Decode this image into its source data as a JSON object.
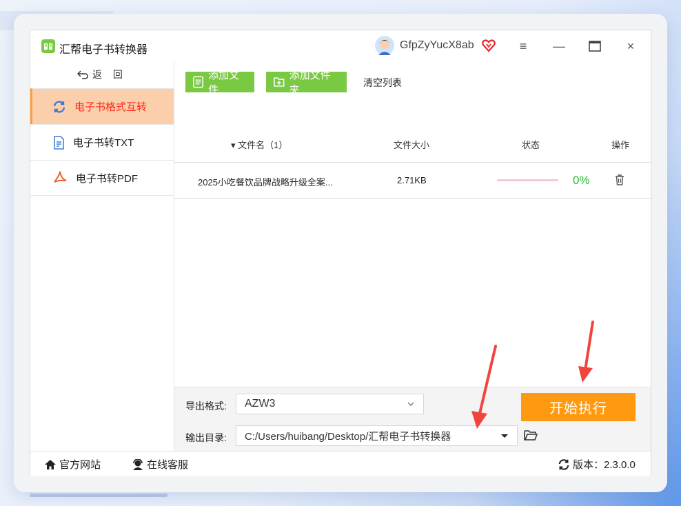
{
  "app": {
    "title": "汇帮电子书转换器",
    "username": "GfpZyYucX8ab"
  },
  "colors": {
    "accent_orange": "#ff9a10",
    "green_button": "#7ac943",
    "active_bg": "#fccfac",
    "active_text": "#ff2a1a",
    "progress_green": "#22bb33"
  },
  "window_controls": {
    "menu": "≡",
    "minimize": "—",
    "maximize": "▭",
    "close": "×"
  },
  "sidebar": {
    "back_label": "返 回",
    "items": [
      {
        "label": "电子书格式互转",
        "icon": "sync-icon",
        "active": true
      },
      {
        "label": "电子书转TXT",
        "icon": "document-icon",
        "active": false
      },
      {
        "label": "电子书转PDF",
        "icon": "pdf-icon",
        "active": false
      }
    ]
  },
  "toolbar": {
    "add_file": "添加文件",
    "add_folder": "添加文件夹",
    "clear_list": "清空列表"
  },
  "table": {
    "headers": {
      "filename": "▾ 文件名（1）",
      "size": "文件大小",
      "status": "状态",
      "action": "操作"
    },
    "rows": [
      {
        "filename": "2025小吃餐饮品牌战略升级全案...",
        "size": "2.71KB",
        "progress": 0,
        "percent_text": "0%"
      }
    ]
  },
  "settings": {
    "format_label": "导出格式:",
    "format_value": "AZW3",
    "output_label": "输出目录:",
    "output_value": "C:/Users/huibang/Desktop/汇帮电子书转换器",
    "start_button": "开始执行"
  },
  "footer": {
    "website": "官方网站",
    "support": "在线客服",
    "version": "版本：2.3.0.0"
  }
}
